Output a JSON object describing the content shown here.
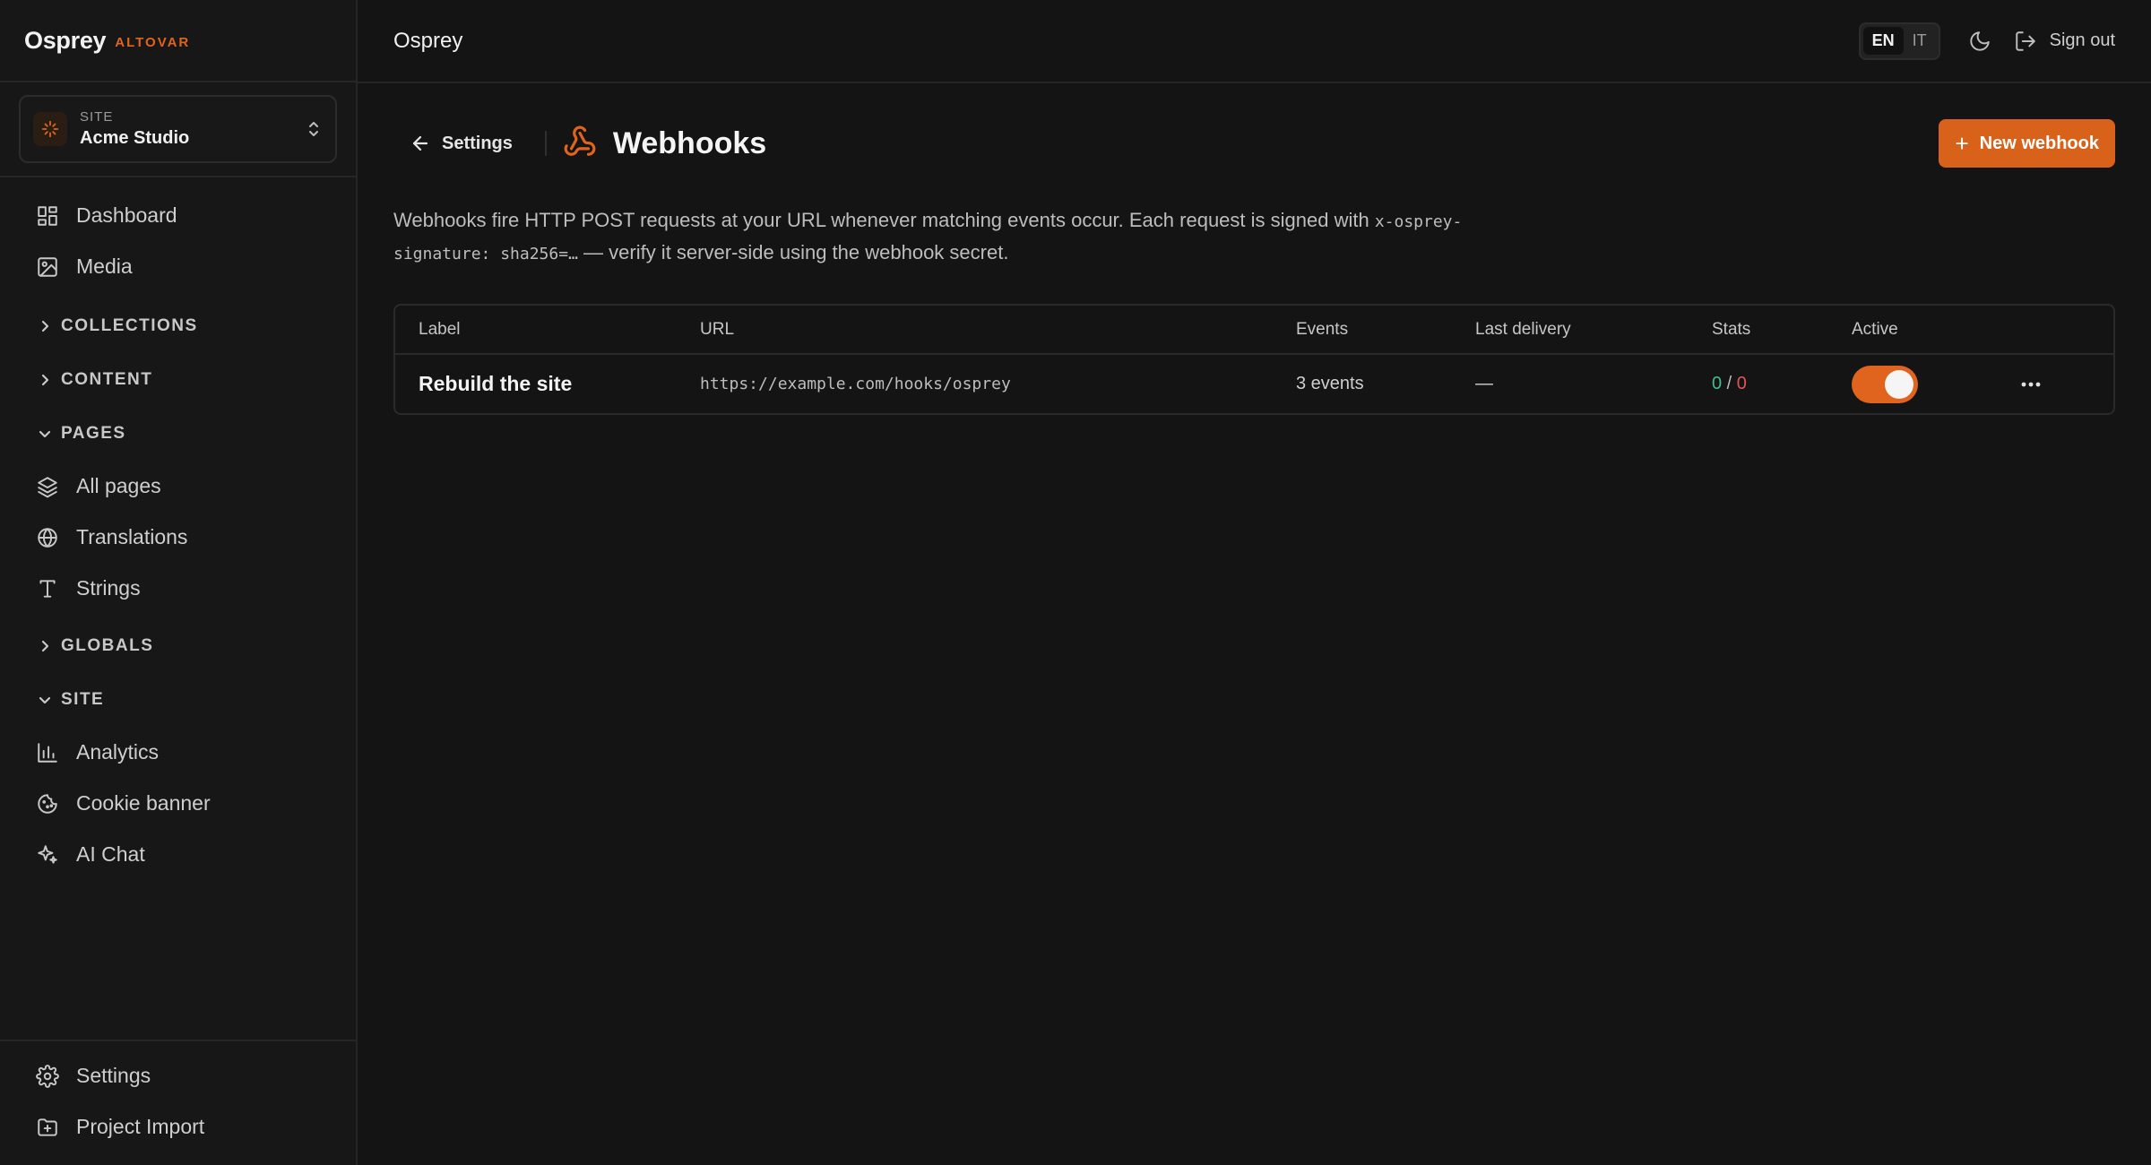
{
  "brand": {
    "name": "Osprey",
    "org": "ALTOVAR"
  },
  "site_switcher": {
    "caption": "SITE",
    "name": "Acme Studio"
  },
  "nav": {
    "dashboard": "Dashboard",
    "media": "Media",
    "collections": "COLLECTIONS",
    "content": "CONTENT",
    "pages": "PAGES",
    "all_pages": "All pages",
    "translations": "Translations",
    "strings": "Strings",
    "globals": "GLOBALS",
    "site": "SITE",
    "analytics": "Analytics",
    "cookie_banner": "Cookie banner",
    "ai_chat": "AI Chat",
    "settings": "Settings",
    "project_import": "Project Import"
  },
  "topbar": {
    "title": "Osprey",
    "lang_en": "EN",
    "lang_it": "IT",
    "sign_out": "Sign out"
  },
  "page": {
    "back_label": "Settings",
    "title": "Webhooks",
    "new_button": "New webhook",
    "desc_part1": "Webhooks fire HTTP POST requests at your URL whenever matching events occur. Each request is signed with ",
    "desc_code": "x-osprey-signature: sha256=…",
    "desc_part2": " — verify it server-side using the webhook secret."
  },
  "table": {
    "headers": {
      "label": "Label",
      "url": "URL",
      "events": "Events",
      "last_delivery": "Last delivery",
      "stats": "Stats",
      "active": "Active"
    },
    "rows": [
      {
        "label": "Rebuild the site",
        "url": "https://example.com/hooks/osprey",
        "events": "3 events",
        "last_delivery": "—",
        "stats_ok": "0",
        "stats_sep": " / ",
        "stats_fail": "0",
        "active": true
      }
    ]
  },
  "colors": {
    "accent": "#d9621a",
    "success": "#3fc08a",
    "danger": "#e0555a"
  }
}
